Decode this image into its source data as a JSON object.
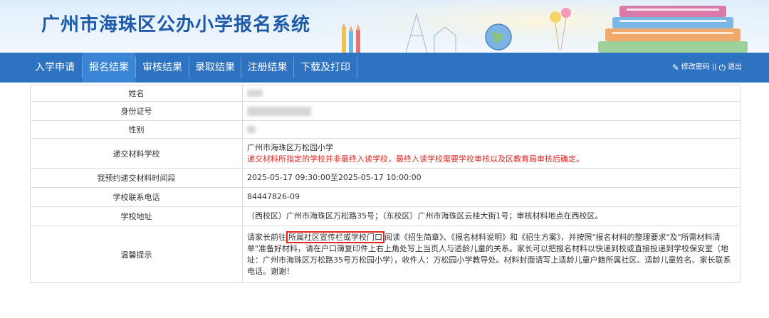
{
  "header": {
    "title": "广州市海珠区公办小学报名系统"
  },
  "nav": {
    "items": [
      {
        "label": "入学申请"
      },
      {
        "label": "报名结果"
      },
      {
        "label": "审核结果"
      },
      {
        "label": "录取结果"
      },
      {
        "label": "注册结果"
      },
      {
        "label": "下载及打印"
      }
    ],
    "active_index": 1,
    "change_password": "修改密码",
    "separator": "||",
    "logout": "退出"
  },
  "table": {
    "rows": [
      {
        "label": "姓名"
      },
      {
        "label": "身份证号"
      },
      {
        "label": "性别"
      },
      {
        "label": "递交材料学校",
        "value": "广州市海珠区万松园小学",
        "note": "递交材料所指定的学校并非最终入读学校，最终入读学校需要学校审核以及区教育局审核后确定。"
      },
      {
        "label": "我预约递交材料时间段",
        "value": "2025-05-17 09:30:00至2025-05-17 10:00:00"
      },
      {
        "label": "学校联系电话",
        "value": "84447826-09"
      },
      {
        "label": "学校地址",
        "value": "（西校区）广州市海珠区万松路35号；（东校区）广州市海珠区云桂大街1号；审核材料地点在西校区。"
      },
      {
        "label": "温馨提示",
        "pre": "请家长前往",
        "highlight": "所属社区宣传栏或学校门口",
        "post": "阅读《招生简章》、《报名材料说明》和《招生方案》，并按照\"报名材料的整理要求\"及\"所需材料清单\"准备好材料，请在户口簿复印件上右上角处写上当页人与适龄儿童的关系。家长可以把报名材料以快递到校或直接投递到学校保安室（地址：广州市海珠区万松路35号万松园小学），收件人：万松园小学教导处。材料封面请写上适龄儿童户籍所属社区、适龄儿童姓名、家长联系电话。谢谢！"
      }
    ]
  },
  "colors": {
    "nav_bg": "#2e73c1",
    "nav_active": "#3a85d6",
    "title": "#1e5aa8",
    "warning": "#e0261f"
  }
}
